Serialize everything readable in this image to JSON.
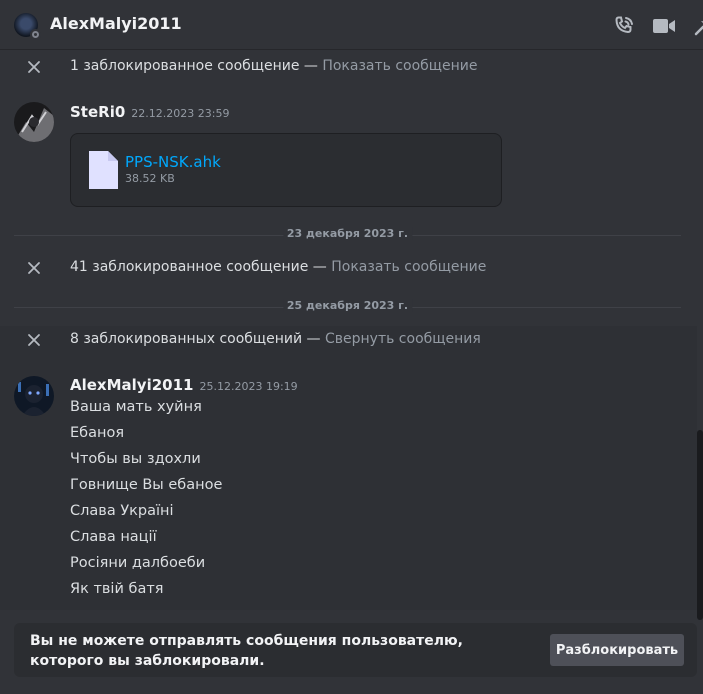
{
  "header": {
    "title": "AlexMalyi2011",
    "icons": [
      "voice-call-icon",
      "video-call-icon",
      "pin-icon"
    ]
  },
  "blocked_notices": [
    {
      "text": "1 заблокированное сообщение — ",
      "link": "Показать сообщение"
    },
    {
      "text": "41 заблокированное сообщение — ",
      "link": "Показать сообщение"
    },
    {
      "text": "8 заблокированных сообщений — ",
      "link": "Свернуть сообщения"
    }
  ],
  "separators": [
    "23 декабря 2023 г.",
    "25 декабря 2023 г."
  ],
  "messages": [
    {
      "author": "SteRi0",
      "timestamp": "22.12.2023 23:59",
      "attachment": {
        "name": "PPS-NSK.ahk",
        "size": "38.52 KB"
      }
    },
    {
      "author": "AlexMalyi2011",
      "timestamp": "25.12.2023 19:19",
      "lines": [
        "Ваша мать хуйня",
        "Ебаноя",
        "Чтобы вы здохли",
        "Говнище Вы ебаное",
        "Слава Україні",
        "Слава нації",
        "Росіяни далбоеби",
        "Як твій батя"
      ]
    }
  ],
  "footer": {
    "notice": "Вы не можете отправлять сообщения пользователю, которого вы заблокировали.",
    "button": "Разблокировать"
  },
  "colors": {
    "background": "#313338",
    "link": "#00a8fc",
    "muted": "#949ba4"
  }
}
